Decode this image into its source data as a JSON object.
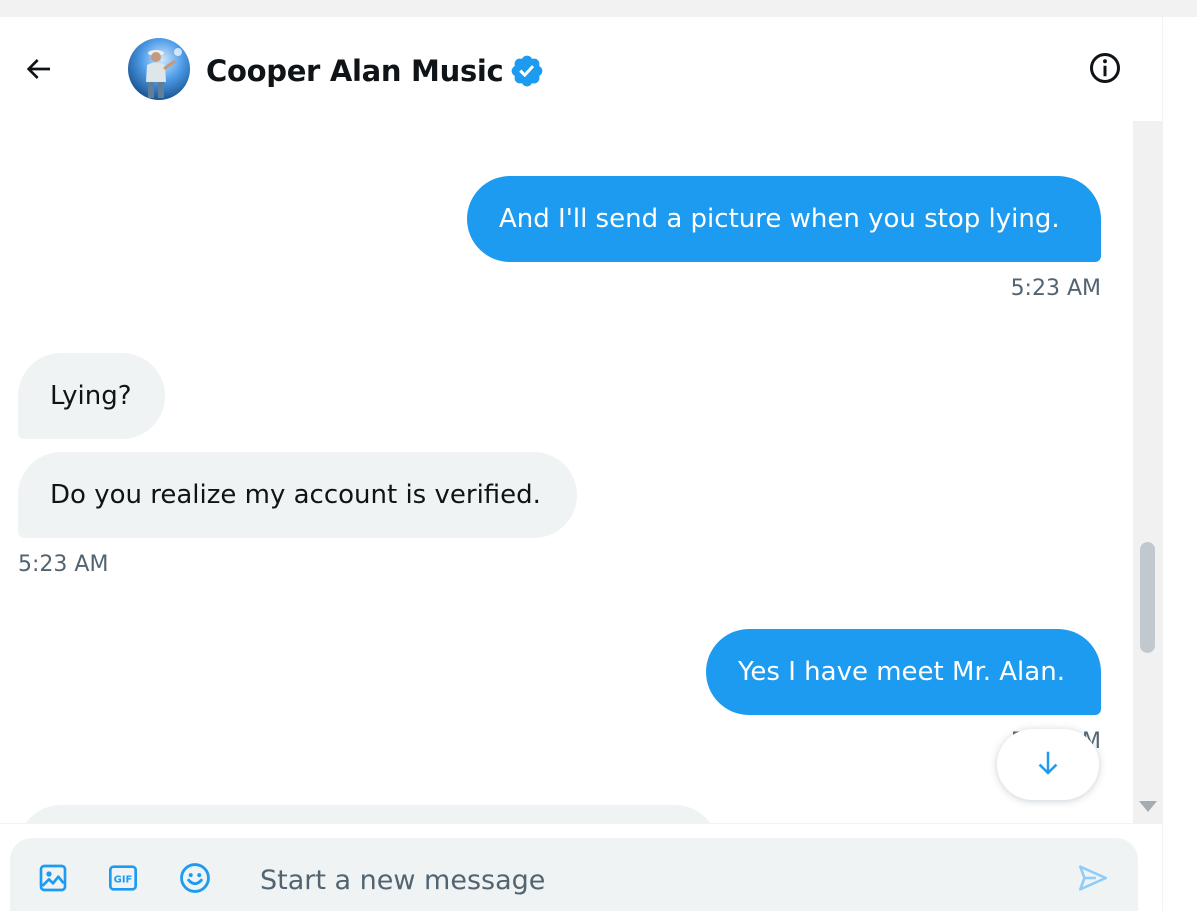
{
  "conversation": {
    "title": "Cooper Alan Music",
    "verified": true
  },
  "header": {
    "back_icon": "arrow-left-icon",
    "info_icon": "info-circle-icon"
  },
  "messages": [
    {
      "direction": "outgoing",
      "text": "And I'll send a picture when you stop lying.",
      "time": "5:23 AM"
    },
    {
      "direction": "incoming",
      "text": "Lying?"
    },
    {
      "direction": "incoming",
      "text": "Do you realize my account is verified.",
      "time": "5:23 AM"
    },
    {
      "direction": "outgoing",
      "text": "Yes I have meet Mr. Alan.",
      "time": "5:23 AM"
    }
  ],
  "composer": {
    "placeholder": "Start a new message",
    "icons": [
      "image-icon",
      "gif-icon",
      "emoji-icon",
      "send-icon"
    ]
  },
  "colors": {
    "accent": "#1d9bf0",
    "incoming_bubble": "#eff3f4",
    "muted_text": "#536471"
  }
}
